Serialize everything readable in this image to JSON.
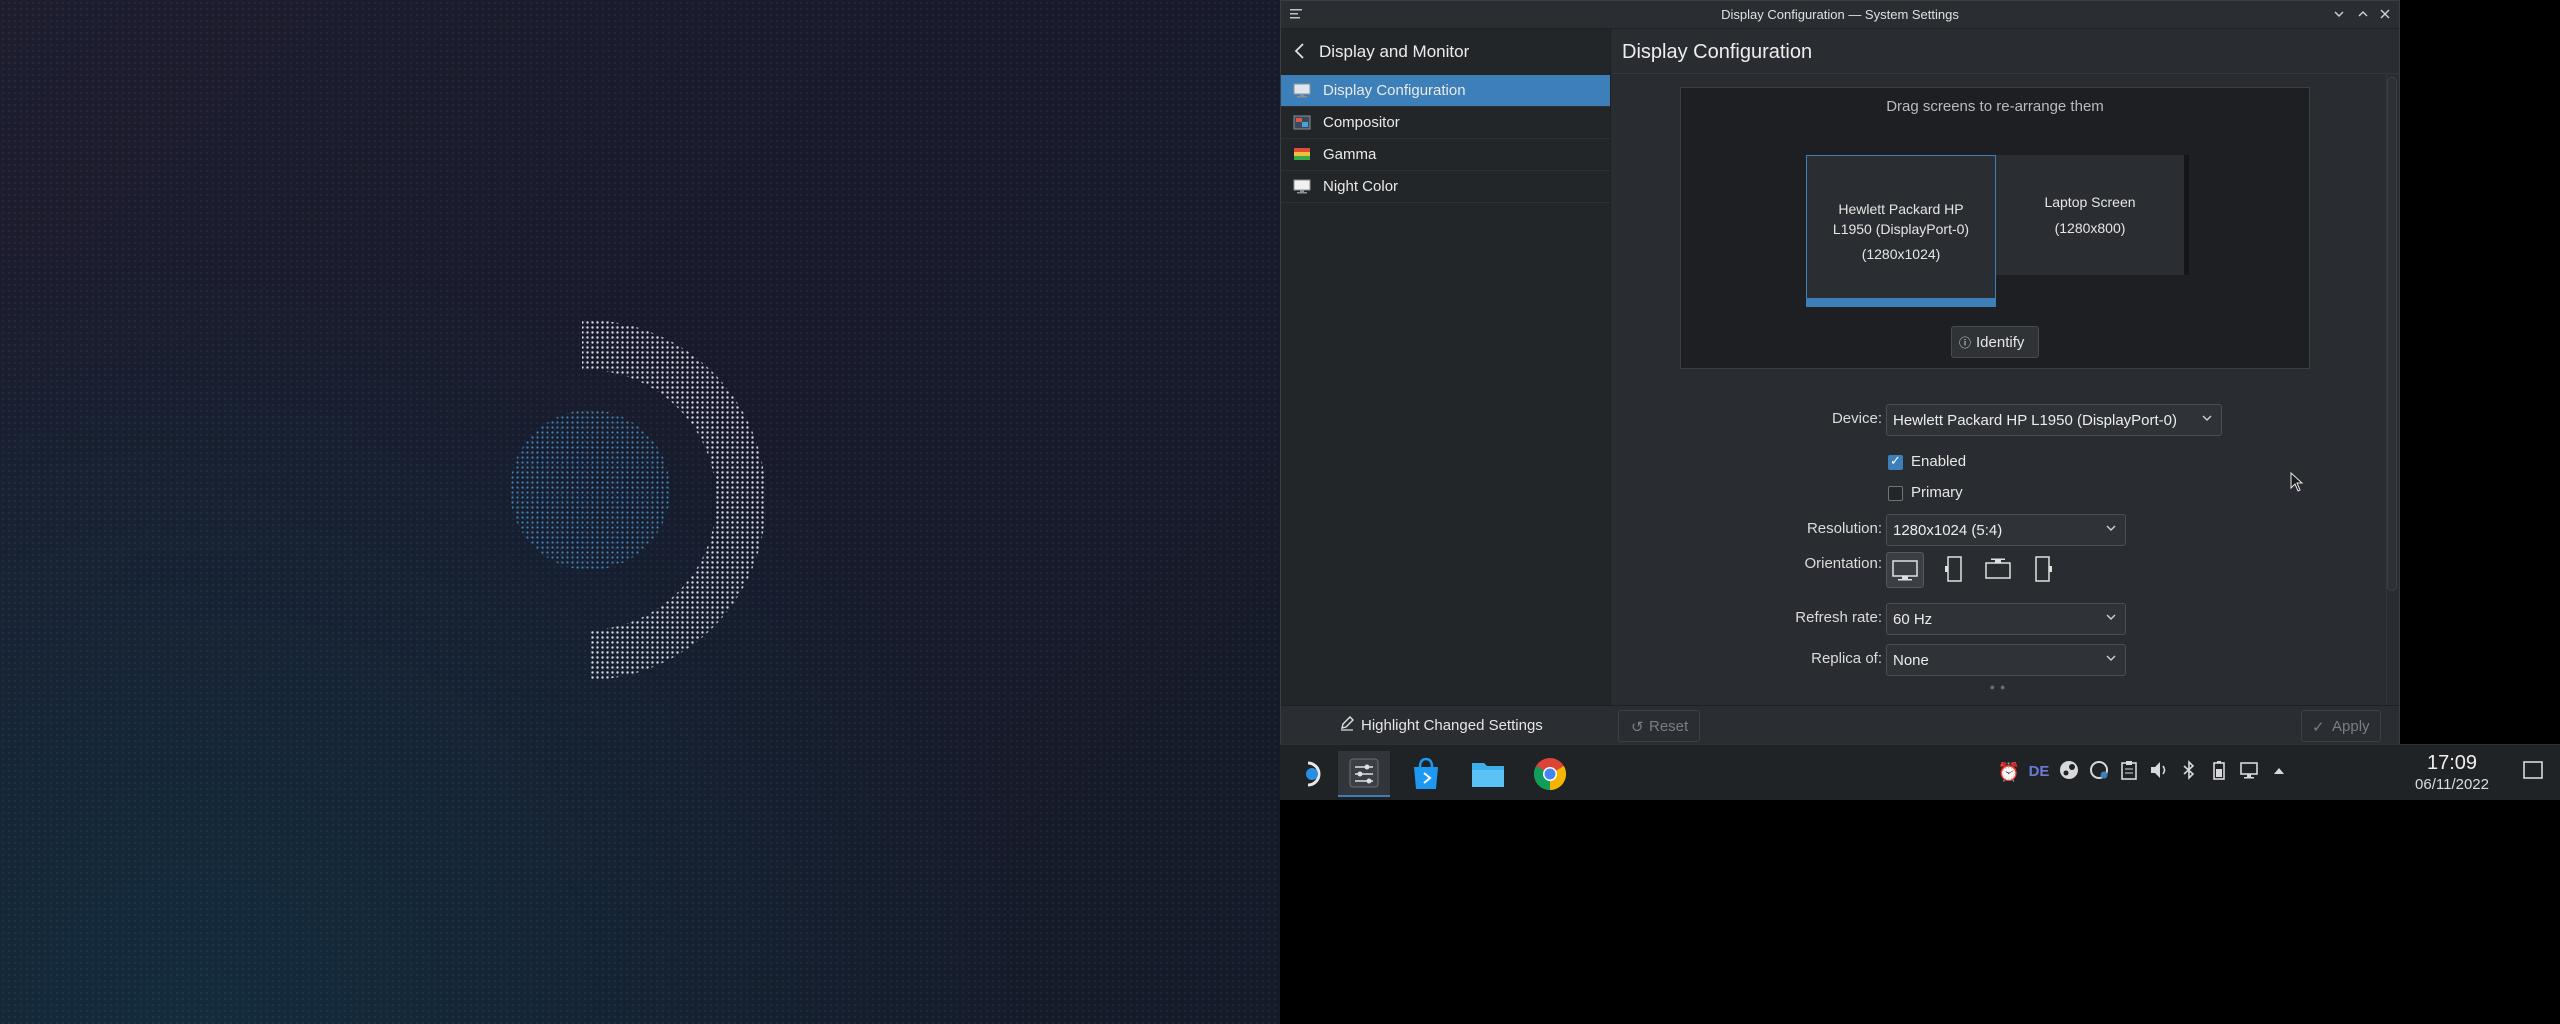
{
  "window": {
    "title": "Display Configuration — System Settings"
  },
  "sidebar": {
    "title": "Display and Monitor",
    "items": [
      {
        "label": "Display Configuration",
        "icon": "monitor-icon",
        "active": true
      },
      {
        "label": "Compositor",
        "icon": "compositor-icon",
        "active": false
      },
      {
        "label": "Gamma",
        "icon": "gamma-icon",
        "active": false
      },
      {
        "label": "Night Color",
        "icon": "night-color-icon",
        "active": false
      }
    ],
    "highlight_label": "Highlight Changed Settings"
  },
  "main": {
    "title": "Display Configuration",
    "drag_hint": "Drag screens to re-arrange them",
    "screens": [
      {
        "line1": "Hewlett Packard HP",
        "line2": "L1950 (DisplayPort-0)",
        "line3": "(1280x1024)",
        "selected": true
      },
      {
        "line1": "Laptop Screen",
        "line2": "(1280x800)",
        "selected": false
      }
    ],
    "identify_label": "Identify",
    "form": {
      "device_label": "Device:",
      "device_value": "Hewlett Packard HP L1950 (DisplayPort-0)",
      "enabled_label": "Enabled",
      "enabled": true,
      "primary_label": "Primary",
      "primary": false,
      "resolution_label": "Resolution:",
      "resolution_value": "1280x1024 (5:4)",
      "orientation_label": "Orientation:",
      "orientation_options": [
        "landscape-icon",
        "portrait-left-icon",
        "landscape-flipped-icon",
        "portrait-right-icon"
      ],
      "refresh_label": "Refresh rate:",
      "refresh_value": "60 Hz",
      "replica_label": "Replica of:",
      "replica_value": "None"
    },
    "reset_label": "Reset",
    "apply_label": "Apply"
  },
  "taskbar": {
    "apps": [
      "steam-deck-launcher-icon",
      "system-settings-icon",
      "discover-store-icon",
      "file-manager-icon",
      "chrome-icon"
    ],
    "tray": [
      "notifications-icon",
      "keyboard-layout-de",
      "steam-icon",
      "clipboard-update-icon",
      "clipboard-icon",
      "volume-icon",
      "bluetooth-icon",
      "battery-icon",
      "network-icon",
      "expand-tray-icon"
    ],
    "keyboard_layout": "DE",
    "clock_time": "17:09",
    "clock_date": "06/11/2022"
  },
  "colors": {
    "accent": "#3d7fb8",
    "window_bg": "#292c30",
    "sidebar_bg": "#232629",
    "taskbar_bg": "#202326"
  }
}
